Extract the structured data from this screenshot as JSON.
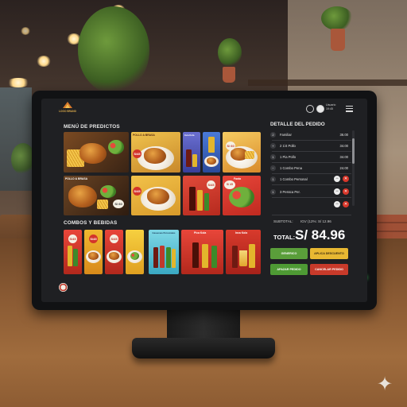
{
  "app": {
    "logo_text": "LOGO BRAND"
  },
  "header": {
    "user_name": "Usuario",
    "user_time": "19:45"
  },
  "menu_section": {
    "title": "MENÚ DE PREDICTOS",
    "cards": [
      {
        "caption": "",
        "price": ""
      },
      {
        "caption": "POLLO A BRASA",
        "price": "S/45"
      },
      {
        "caption": "Inca Kola",
        "price": ""
      },
      {
        "caption": "",
        "price": ""
      },
      {
        "caption": "",
        "price": "S/ 60"
      },
      {
        "caption": "POLLO & BRASA",
        "price": "S/ 60"
      },
      {
        "caption": "",
        "price": "S/45"
      },
      {
        "caption": "",
        "price": "S/45"
      },
      {
        "caption": "Fanta",
        "price": "S/ 45"
      }
    ]
  },
  "combos_section": {
    "title": "COMBOS Y BEBIDAS",
    "cards": [
      {
        "caption": "",
        "price": "S/45"
      },
      {
        "caption": "",
        "price": "S/45"
      },
      {
        "caption": "",
        "price": "S/45"
      },
      {
        "caption": "",
        "price": ""
      },
      {
        "caption": "Gaseosas Personales",
        "price": ""
      },
      {
        "caption": "Pica Kola",
        "price": ""
      },
      {
        "caption": "Inca Kola",
        "price": ""
      }
    ]
  },
  "order": {
    "title": "DETALLE DEL PEDIDO",
    "items": [
      {
        "qty": "2",
        "name": "Familiar",
        "amount": "36.00"
      },
      {
        "qty": "+",
        "name": "2 1/4 Pollo",
        "amount": "34.00"
      },
      {
        "qty": "1",
        "name": "1 Pia Pollo",
        "amount": "34.00"
      },
      {
        "qty": "−",
        "name": "1 Combo Pena",
        "amount": "24.00"
      },
      {
        "qty": "1",
        "name": "1 Combo Personal",
        "amount": ""
      },
      {
        "qty": "1",
        "name": "3 Pessca Per.",
        "amount": ""
      },
      {
        "qty": "",
        "name": "",
        "amount": ""
      }
    ],
    "subtotal_label": "SUBTOTAL:",
    "igv_label": "IGV (12%: S/ 12.96",
    "total_label": "TOTAL:",
    "total_value": "S/ 84.96",
    "buttons": {
      "generic": "GENERICO",
      "discount": "APLICA DESCUENTO",
      "save": "APAZAR PEDIDO",
      "cancel": "CANCELAR PEDIDO"
    }
  },
  "colors": {
    "screen_bg": "#1f2023",
    "accent_green": "#5a9e3a",
    "accent_yellow": "#e8b832",
    "accent_red": "#c83a2a",
    "price_badge_red": "#d3342a"
  },
  "icons": [
    "logo-mark-icon",
    "search-icon",
    "user-icon",
    "menu-icon",
    "minus-icon",
    "delete-icon",
    "sparkle-icon",
    "brand-badge-icon"
  ]
}
